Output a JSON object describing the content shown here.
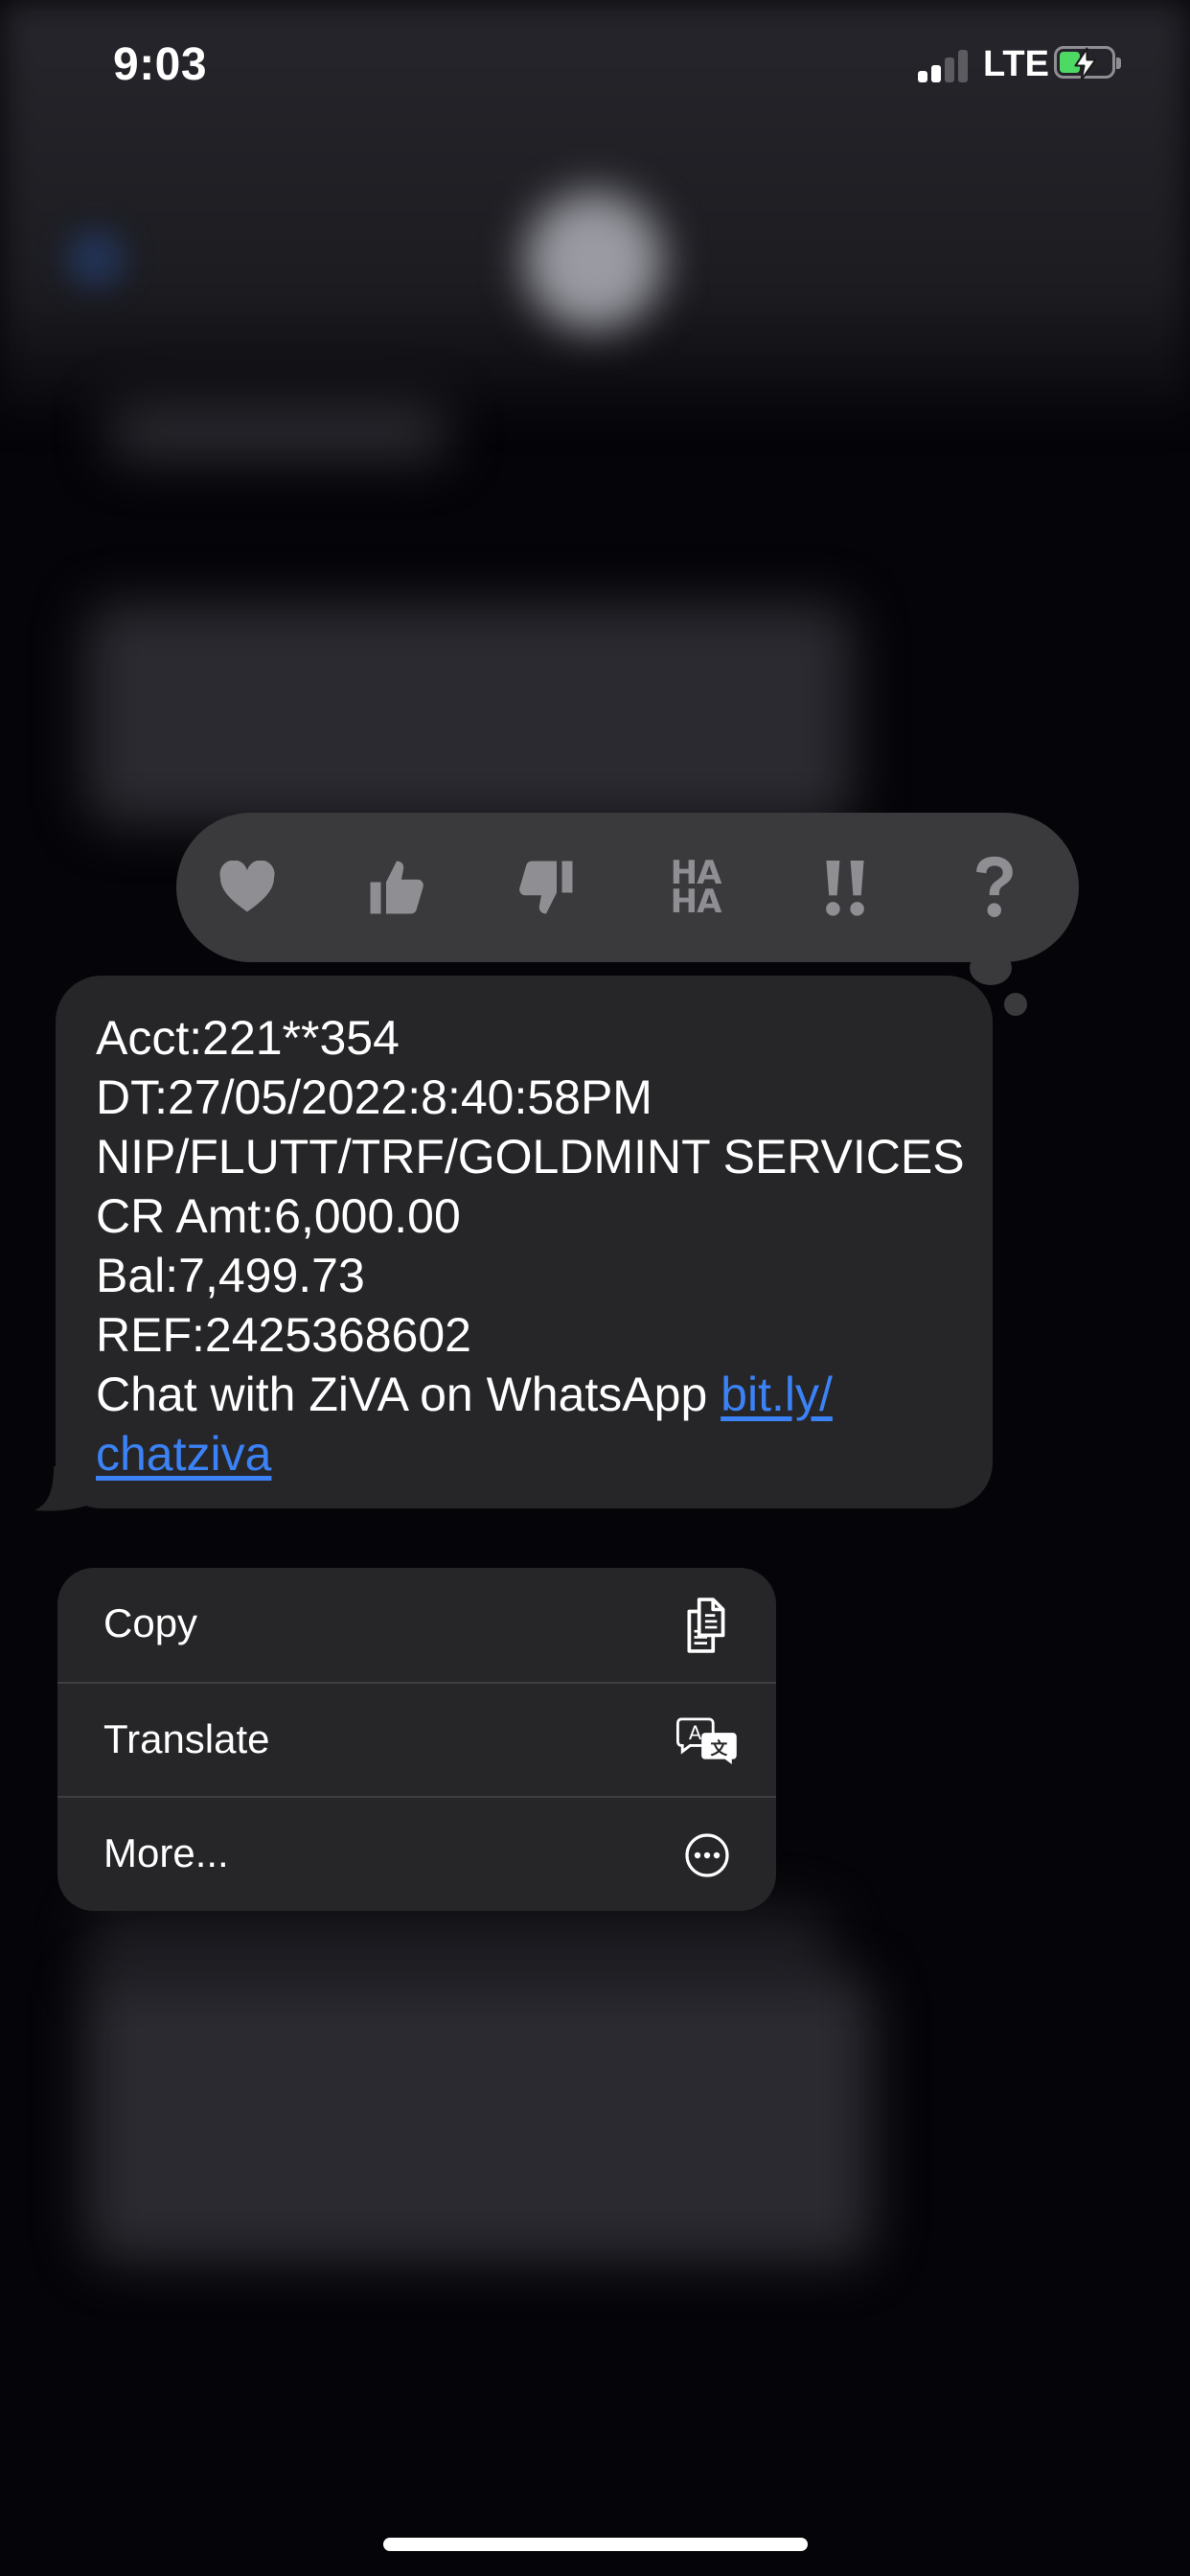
{
  "status_bar": {
    "time": "9:03",
    "network": "LTE",
    "signal_bars_active": 2,
    "signal_bars_total": 4,
    "battery_level": 0.4,
    "battery_charging": true,
    "battery_color": "#4cd964"
  },
  "tapbacks": [
    {
      "name": "heart-icon"
    },
    {
      "name": "thumbs-up-icon"
    },
    {
      "name": "thumbs-down-icon"
    },
    {
      "name": "haha-icon",
      "line1": "HA",
      "line2": "HA"
    },
    {
      "name": "exclamation-icon"
    },
    {
      "name": "question-icon"
    }
  ],
  "message": {
    "lines": [
      "Acct:221**354",
      "DT:27/05/2022:8:40:58PM",
      "NIP/FLUTT/TRF/GOLDMINT SERVICES",
      "CR Amt:6,000.00",
      "Bal:7,499.73",
      "REF:2425368602"
    ],
    "chat_text": "Chat with ZiVA on WhatsApp ",
    "link_part1": "bit.ly/",
    "link_part2": "chatziva",
    "link_color": "#3b82f6"
  },
  "menu": {
    "items": [
      {
        "label": "Copy",
        "icon": "copy-icon"
      },
      {
        "label": "Translate",
        "icon": "translate-icon"
      },
      {
        "label": "More...",
        "icon": "more-icon"
      }
    ]
  }
}
